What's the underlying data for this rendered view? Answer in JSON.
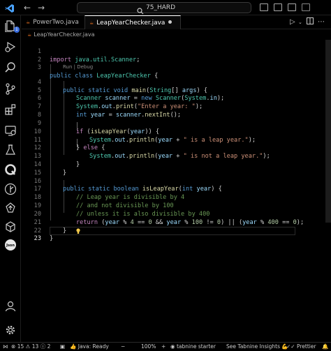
{
  "titlebar": {
    "search_label": "75_HARD",
    "nav_back": "←",
    "nav_forward": "→"
  },
  "tabs": [
    {
      "label": "PowerTwo.java"
    },
    {
      "label": "LeapYearChecker.java",
      "active": true
    }
  ],
  "breadcrumb": {
    "file": "LeapYearChecker.java"
  },
  "editor": {
    "codelens": "Run | Debug",
    "lines": [
      {
        "n": "1"
      },
      {
        "n": "2"
      },
      {
        "n": "3"
      },
      {
        "n": "4"
      },
      {
        "n": "5"
      },
      {
        "n": "6"
      },
      {
        "n": "7"
      },
      {
        "n": "8"
      },
      {
        "n": "9"
      },
      {
        "n": "10"
      },
      {
        "n": "11"
      },
      {
        "n": "12"
      },
      {
        "n": "13"
      },
      {
        "n": "14"
      },
      {
        "n": "15"
      },
      {
        "n": "16"
      },
      {
        "n": "17"
      },
      {
        "n": "18"
      },
      {
        "n": "19"
      },
      {
        "n": "20"
      },
      {
        "n": "21"
      },
      {
        "n": "22"
      },
      {
        "n": "23"
      }
    ],
    "code": {
      "l1_import": "import",
      "l1_pkg": "java.util.Scanner",
      "l1_semi": ";",
      "l3_public": "public",
      "l3_class": "class",
      "l3_name": "LeapYearChecker",
      "l3_brace": "{",
      "l4_public": "public",
      "l4_static": "static",
      "l4_void": "void",
      "l4_main": "main",
      "l4_open": "(",
      "l4_type": "String",
      "l4_arr": "[] ",
      "l4_args": "args",
      "l4_close": ") {",
      "l5_type": "Scanner",
      "l5_var": "scanner",
      "l5_eq": " = ",
      "l5_new": "new",
      "l5_ctor": "Scanner",
      "l5_open": "(",
      "l5_sys": "System",
      "l5_dot": ".",
      "l5_in": "in",
      "l5_close": ");",
      "l6_sys": "System",
      "l6_dot1": ".",
      "l6_out": "out",
      "l6_dot2": ".",
      "l6_print": "print",
      "l6_open": "(",
      "l6_str": "\"Enter a year: \"",
      "l6_close": ");",
      "l7_int": "int",
      "l7_var": "year",
      "l7_eq": " = ",
      "l7_scanner": "scanner",
      "l7_dot": ".",
      "l7_next": "nextInt",
      "l7_close": "();",
      "l9_if": "if",
      "l9_open": " (",
      "l9_fn": "isLeapYear",
      "l9_paren": "(",
      "l9_arg": "year",
      "l9_close": ")) {",
      "l10_sys": "System",
      "l10_dot1": ".",
      "l10_out": "out",
      "l10_dot2": ".",
      "l10_println": "println",
      "l10_open": "(",
      "l10_var": "year",
      "l10_plus": " + ",
      "l10_str": "\" is a leap year.\"",
      "l10_close": ");",
      "l11_brace": "} ",
      "l11_else": "else",
      "l11_open": " {",
      "l12_sys": "System",
      "l12_dot1": ".",
      "l12_out": "out",
      "l12_dot2": ".",
      "l12_println": "println",
      "l12_open": "(",
      "l12_var": "year",
      "l12_plus": " + ",
      "l12_str": "\" is not a leap year.\"",
      "l12_close": ");",
      "l13_brace": "}",
      "l14_brace": "}",
      "l16_public": "public",
      "l16_static": "static",
      "l16_boolean": "boolean",
      "l16_fn": "isLeapYear",
      "l16_open": "(",
      "l16_int": "int",
      "l16_param": "year",
      "l16_close": ") {",
      "l17_comment": "// Leap year is divisible by 4",
      "l18_comment": "// and not divisible by 100",
      "l19_comment": "// unless it is also divisible by 400",
      "l20_return": "return",
      "l20_p1": " (",
      "l20_y1": "year",
      "l20_mod1": " % ",
      "l20_n4": "4",
      "l20_eq1": " == ",
      "l20_n0a": "0",
      "l20_and": " && ",
      "l20_y2": "year",
      "l20_mod2": " % ",
      "l20_n100": "100",
      "l20_ne": " != ",
      "l20_n0b": "0",
      "l20_or": ") || (",
      "l20_y3": "year",
      "l20_mod3": " % ",
      "l20_n400": "400",
      "l20_eq2": " == ",
      "l20_n0c": "0",
      "l20_end": ");",
      "l21_brace": "}",
      "l22_brace": "}"
    }
  },
  "statusbar": {
    "errors": "15",
    "warnings": "13",
    "info": "2",
    "java_status": "Java: Ready",
    "zoom": "100%",
    "tabnine": "tabnine starter",
    "insights": "See Tabnine Insights",
    "prettier": "Prettier"
  },
  "colors": {
    "keyword_control": "#c586c0",
    "keyword": "#569cd6",
    "type": "#4ec9b0",
    "function": "#dcdcaa",
    "string": "#ce9178",
    "comment": "#6a9955",
    "number": "#b5cea8",
    "variable": "#9cdcfe"
  }
}
